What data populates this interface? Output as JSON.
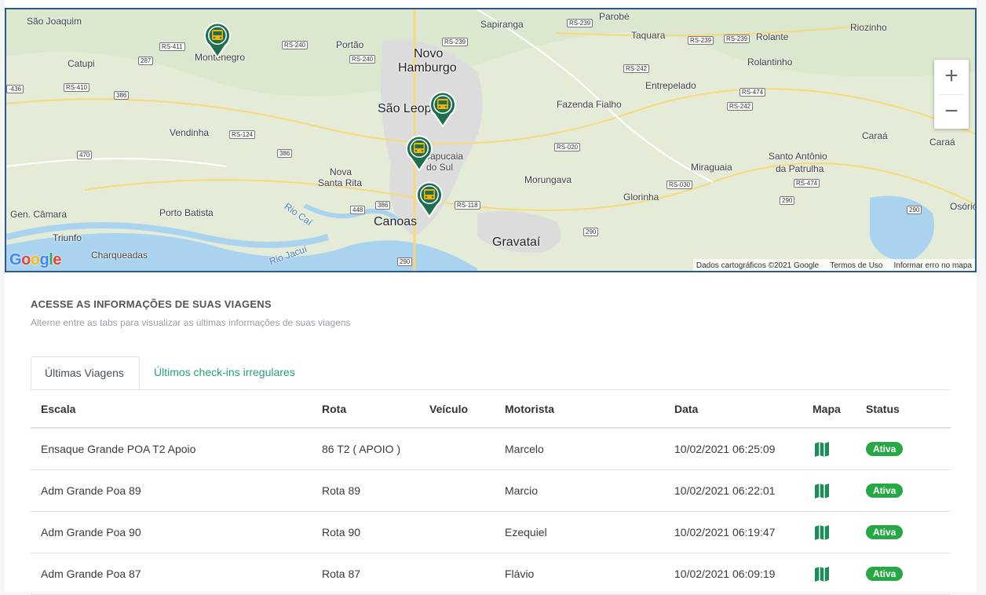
{
  "map": {
    "places": [
      {
        "name": "São Joaquim",
        "big": false
      },
      {
        "name": "Catupi",
        "big": false
      },
      {
        "name": "Montenegro",
        "big": false
      },
      {
        "name": "Portão",
        "big": false
      },
      {
        "name": "Novo",
        "big": true
      },
      {
        "name": "Hamburgo",
        "big": true
      },
      {
        "name": "Sapiranga",
        "big": false
      },
      {
        "name": "Parobé",
        "big": false
      },
      {
        "name": "Taquara",
        "big": false
      },
      {
        "name": "Rolante",
        "big": false
      },
      {
        "name": "Riozinho",
        "big": false
      },
      {
        "name": "Rolantinho",
        "big": false
      },
      {
        "name": "Entrepelado",
        "big": false
      },
      {
        "name": "Fazenda Fialho",
        "big": false
      },
      {
        "name": "São Leop",
        "big": true
      },
      {
        "name": "Vendinha",
        "big": false
      },
      {
        "name": "Sapucaia",
        "big": false
      },
      {
        "name": "do Sul",
        "big": false
      },
      {
        "name": "Nova",
        "big": false
      },
      {
        "name": "Santa Rita",
        "big": false
      },
      {
        "name": "Morungava",
        "big": false
      },
      {
        "name": "Miraguaia",
        "big": false
      },
      {
        "name": "Santo Antônio",
        "big": false
      },
      {
        "name": "da Patrulha",
        "big": false
      },
      {
        "name": "Caraá",
        "big": false
      },
      {
        "name": "Caraá",
        "big": false
      },
      {
        "name": "Glorinha",
        "big": false
      },
      {
        "name": "Gen. Câmara",
        "big": false
      },
      {
        "name": "Porto Batista",
        "big": false
      },
      {
        "name": "Rio Caí",
        "big": false
      },
      {
        "name": "Canoas",
        "big": true
      },
      {
        "name": "Gravataí",
        "big": true
      },
      {
        "name": "Osório",
        "big": false
      },
      {
        "name": "Triunfo",
        "big": false
      },
      {
        "name": "Charqueadas",
        "big": false
      },
      {
        "name": "Rio Jacuí",
        "big": false
      }
    ],
    "roads": [
      "RS-411",
      "RS-240",
      "RS-240",
      "RS-239",
      "RS-239",
      "RS-239",
      "RS-239",
      "287",
      "287",
      "RS-410",
      "386",
      "RS-242",
      "RS-474",
      "RS-242",
      "RS-124",
      "386",
      "RS-020",
      "470",
      "RS-030",
      "RS-474",
      "448",
      "386",
      "RS-118",
      "290",
      "290",
      "290",
      "290",
      "-436"
    ],
    "zoom_in": "+",
    "zoom_out": "−",
    "attribution": {
      "data": "Dados cartográficos ©2021 Google",
      "terms": "Termos de Uso",
      "report": "Informar erro no mapa"
    },
    "logo": "Google",
    "logo_colors": [
      "#4285f4",
      "#ea4335",
      "#fbbc05",
      "#4285f4",
      "#34a853",
      "#ea4335"
    ],
    "pin_color": "#1f6e4e",
    "pin_icon": "bus-icon"
  },
  "section": {
    "title": "ACESSE AS INFORMAÇÕES DE SUAS VIAGENS",
    "subtitle": "Alterne entre as tabs para visualizar as últimas informações de suas viagens"
  },
  "tabs": [
    {
      "label": "Últimas Viagens",
      "active": true
    },
    {
      "label": "Últimos check-ins irregulares",
      "active": false
    }
  ],
  "table": {
    "columns": [
      "Escala",
      "Rota",
      "Veículo",
      "Motorista",
      "Data",
      "Mapa",
      "Status"
    ],
    "rows": [
      {
        "escala": "Ensaque Grande POA T2 Apoio",
        "rota": "86 T2 ( APOIO )",
        "veiculo": "",
        "motorista": "Marcelo",
        "data": "10/02/2021 06:25:09",
        "mapa": "map-icon",
        "status": "Ativa"
      },
      {
        "escala": "Adm Grande Poa 89",
        "rota": "Rota 89",
        "veiculo": "",
        "motorista": "Marcio",
        "data": "10/02/2021 06:22:01",
        "mapa": "map-icon",
        "status": "Ativa"
      },
      {
        "escala": "Adm Grande Poa 90",
        "rota": "Rota 90",
        "veiculo": "",
        "motorista": "Ezequiel",
        "data": "10/02/2021 06:19:47",
        "mapa": "map-icon",
        "status": "Ativa"
      },
      {
        "escala": "Adm Grande Poa 87",
        "rota": "Rota 87",
        "veiculo": "",
        "motorista": "Flávio",
        "data": "10/02/2021 06:09:19",
        "mapa": "map-icon",
        "status": "Ativa"
      }
    ]
  },
  "colors": {
    "accent": "#26a07e",
    "status_active": "#28a745",
    "map_icon": "#1f8a5a"
  }
}
